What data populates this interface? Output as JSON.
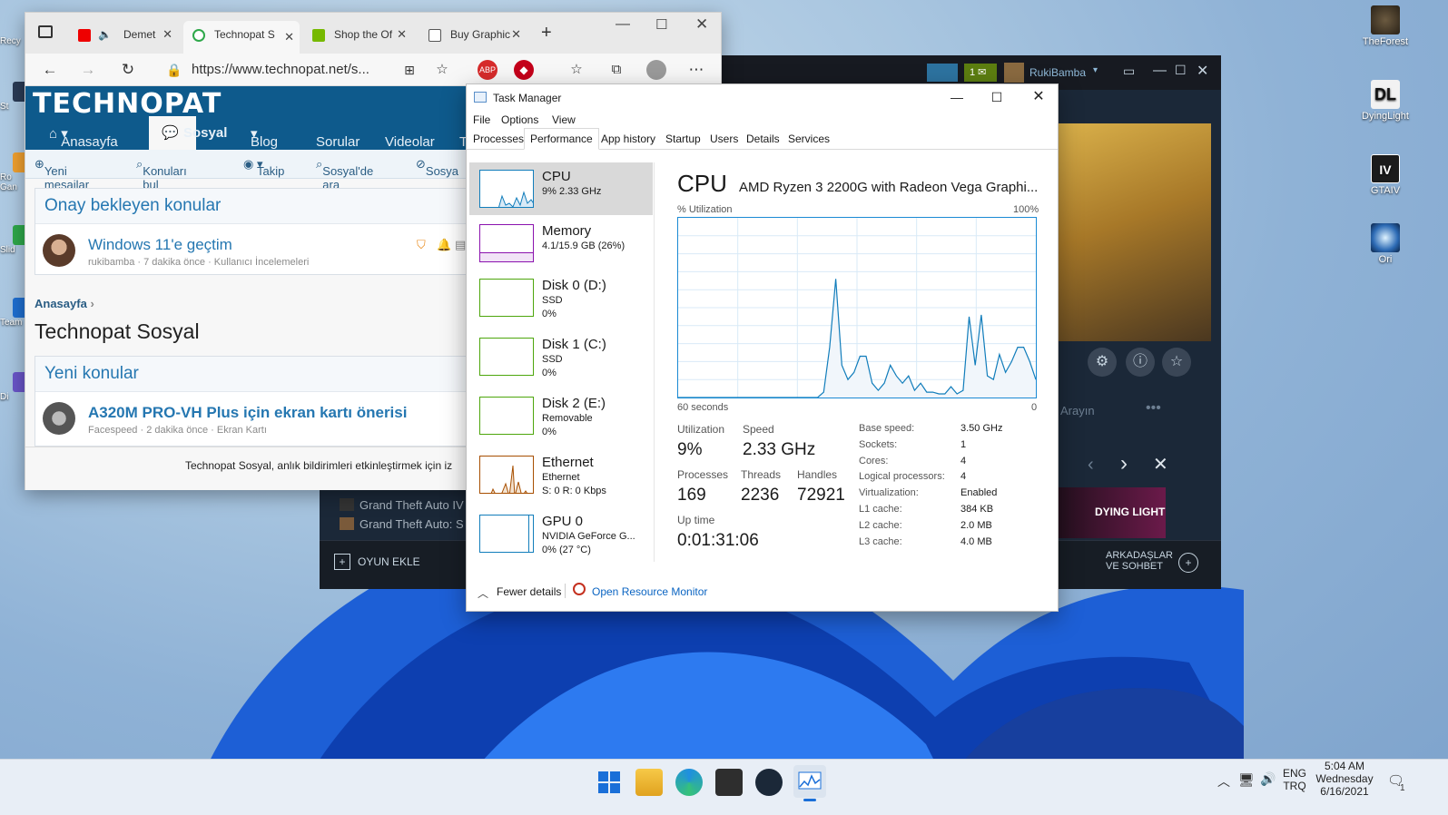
{
  "desktop": {
    "left_icons": [
      "Recy",
      "St",
      "Ro Gan",
      "Slid",
      "Team",
      "Di"
    ],
    "right_icons": [
      {
        "label": "TheForest",
        "icon": "the-forest-icon"
      },
      {
        "label": "DyingLight",
        "icon": "dying-light-icon"
      },
      {
        "label": "GTAIV",
        "icon": "gta-iv-icon"
      },
      {
        "label": "Ori",
        "icon": "ori-icon"
      }
    ]
  },
  "steam": {
    "user": "RukiBamba",
    "notif_count": "1",
    "search_placeholder": "Arayın",
    "games": [
      "Grand Theft Auto IV",
      "Grand Theft Auto: S"
    ],
    "add_game": "OYUN EKLE",
    "friends": "ARKADAŞLAR VE SOHBET",
    "featured": "DYING LIGHT"
  },
  "edge": {
    "tabs": [
      {
        "label": "Demet",
        "active": false
      },
      {
        "label": "Technopat S",
        "active": true
      },
      {
        "label": "Shop the Of",
        "active": false
      },
      {
        "label": "Buy Graphic",
        "active": false
      }
    ],
    "url": "https://www.technopat.net/s...",
    "site": {
      "logo": "TECHNOPAT",
      "nav": [
        "Anasayfa",
        "Sosyal",
        "Blog",
        "Sorular",
        "Videolar",
        "T"
      ],
      "subnav": [
        "Yeni mesajlar",
        "Konuları bul",
        "Takip",
        "Sosyal'de ara",
        "Sosya"
      ],
      "pending_title": "Onay bekleyen konular",
      "pending_post": {
        "title": "Windows 11'e geçtim",
        "meta": "rukibamba · 7 dakika önce · Kullanıcı İncelemeleri"
      },
      "breadcrumb": "Anasayfa",
      "page_title": "Technopat Sosyal",
      "new_title": "Yeni konular",
      "new_post": {
        "title": "A320M PRO-VH Plus için ekran kartı önerisi",
        "meta": "Facespeed · 2 dakika önce · Ekran Kartı"
      },
      "notice": "Technopat Sosyal, anlık bildirimleri etkinleştirmek için iz"
    }
  },
  "taskmanager": {
    "title": "Task Manager",
    "menu": [
      "File",
      "Options",
      "View"
    ],
    "tabs": [
      "Processes",
      "Performance",
      "App history",
      "Startup",
      "Users",
      "Details",
      "Services"
    ],
    "active_tab": "Performance",
    "resources": [
      {
        "name": "CPU",
        "line1": "9%  2.33 GHz",
        "line2": "",
        "color": "#117dbb"
      },
      {
        "name": "Memory",
        "line1": "4.1/15.9 GB (26%)",
        "line2": "",
        "color": "#8b12ae"
      },
      {
        "name": "Disk 0 (D:)",
        "line1": "SSD",
        "line2": "0%",
        "color": "#4da60c"
      },
      {
        "name": "Disk 1 (C:)",
        "line1": "SSD",
        "line2": "0%",
        "color": "#4da60c"
      },
      {
        "name": "Disk 2 (E:)",
        "line1": "Removable",
        "line2": "0%",
        "color": "#4da60c"
      },
      {
        "name": "Ethernet",
        "line1": "Ethernet",
        "line2": "S: 0  R: 0 Kbps",
        "color": "#a74f01"
      },
      {
        "name": "GPU 0",
        "line1": "NVIDIA GeForce G...",
        "line2": "0% (27 °C)",
        "color": "#117dbb"
      }
    ],
    "cpu": {
      "heading": "CPU",
      "model": "AMD Ryzen 3 2200G with Radeon Vega Graphi...",
      "util_label": "% Utilization",
      "max_label": "100%",
      "time_label": "60 seconds",
      "min_label": "0",
      "utilization_label": "Utilization",
      "utilization": "9%",
      "speed_label": "Speed",
      "speed": "2.33 GHz",
      "processes_label": "Processes",
      "processes": "169",
      "threads_label": "Threads",
      "threads": "2236",
      "handles_label": "Handles",
      "handles": "72921",
      "uptime_label": "Up time",
      "uptime": "0:01:31:06",
      "details": [
        {
          "k": "Base speed:",
          "v": "3.50 GHz"
        },
        {
          "k": "Sockets:",
          "v": "1"
        },
        {
          "k": "Cores:",
          "v": "4"
        },
        {
          "k": "Logical processors:",
          "v": "4"
        },
        {
          "k": "Virtualization:",
          "v": "Enabled"
        },
        {
          "k": "L1 cache:",
          "v": "384 KB"
        },
        {
          "k": "L2 cache:",
          "v": "2.0 MB"
        },
        {
          "k": "L3 cache:",
          "v": "4.0 MB"
        }
      ],
      "history": [
        0,
        0,
        0,
        0,
        0,
        0,
        0,
        0,
        0,
        0,
        0,
        0,
        0,
        0,
        0,
        0,
        0,
        0,
        0,
        0,
        0,
        0,
        0,
        0,
        3,
        28,
        66,
        18,
        10,
        14,
        23,
        23,
        8,
        4,
        8,
        18,
        12,
        8,
        12,
        4,
        8,
        3,
        3,
        2,
        2,
        6,
        2,
        4,
        45,
        18,
        46,
        12,
        10,
        24,
        14,
        20,
        28,
        28,
        20,
        10
      ]
    },
    "fewer_details": "Fewer details",
    "resource_monitor": "Open Resource Monitor"
  },
  "taskbar": {
    "lang": "ENG",
    "layout": "TRQ",
    "time": "5:04 AM",
    "day": "Wednesday",
    "date": "6/16/2021",
    "notif": "1"
  }
}
